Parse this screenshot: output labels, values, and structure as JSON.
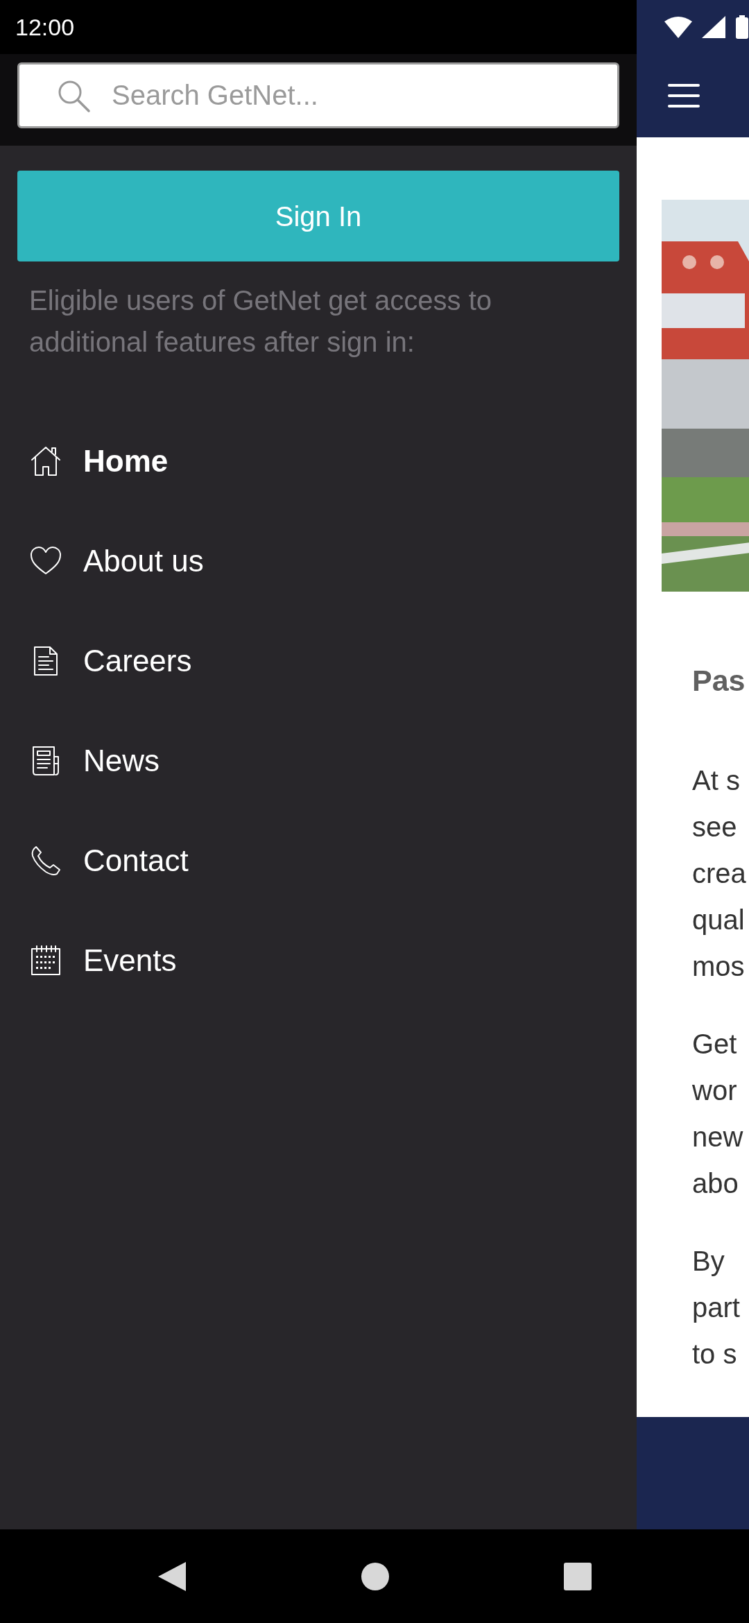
{
  "status_bar": {
    "time": "12:00"
  },
  "drawer": {
    "search": {
      "placeholder": "Search GetNet..."
    },
    "sign_in_button": "Sign In",
    "sign_in_note": "Eligible users of GetNet get access to additional features after sign in:",
    "menu": [
      {
        "label": "Home",
        "kind": "home",
        "selected": true
      },
      {
        "label": "About us",
        "kind": "heart",
        "selected": false
      },
      {
        "label": "Careers",
        "kind": "document",
        "selected": false
      },
      {
        "label": "News",
        "kind": "newspaper",
        "selected": false
      },
      {
        "label": "Contact",
        "kind": "phone",
        "selected": false
      },
      {
        "label": "Events",
        "kind": "calendar",
        "selected": false
      }
    ]
  },
  "page_behind": {
    "image": {
      "kind": "picture"
    },
    "heading": "Pas",
    "paragraphs": [
      [
        "At s",
        "see",
        "crea",
        "qual",
        "mos"
      ],
      [
        "Get",
        "wor",
        "new",
        "abo"
      ],
      [
        "By",
        "part",
        "to s"
      ]
    ]
  }
}
